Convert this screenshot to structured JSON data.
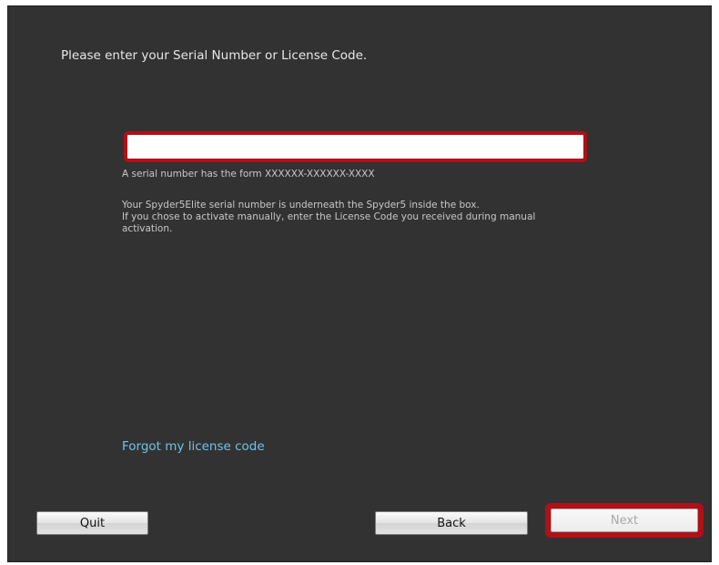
{
  "dialog": {
    "prompt": "Please enter your Serial Number or License Code.",
    "serial_input": {
      "value": "",
      "placeholder": ""
    },
    "hints": {
      "format": "A serial number has the form XXXXXX-XXXXXX-XXXX",
      "location": "Your Spyder5Elite serial number is underneath the Spyder5 inside the box.",
      "manual_line1": "If you chose to activate manually, enter the License Code you received during manual",
      "manual_line2": "activation."
    },
    "forgot_link": "Forgot my license code"
  },
  "buttons": {
    "quit": "Quit",
    "back": "Back",
    "next": "Next",
    "next_enabled": false
  },
  "colors": {
    "background": "#323232",
    "highlight": "#b01018",
    "link": "#6fc3e8"
  }
}
